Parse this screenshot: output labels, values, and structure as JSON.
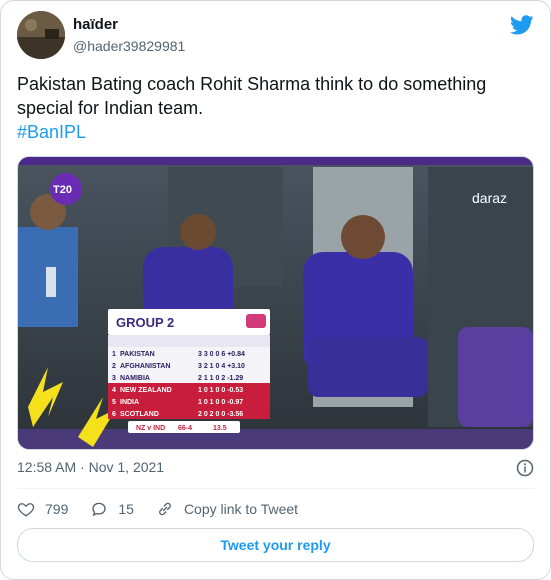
{
  "author": {
    "display_name": "haïder",
    "handle": "@hader39829981"
  },
  "tweet": {
    "text": "Pakistan Bating coach Rohit Sharma think to do something special for Indian team.",
    "hashtag": "#BanIPL",
    "timestamp": "12:58 AM · Nov 1, 2021"
  },
  "media": {
    "watermark": "daraz",
    "t20_logo": "T20",
    "group_table": {
      "title": "GROUP 2",
      "rows": [
        {
          "pos": "1",
          "team": "PAKISTAN",
          "vals": "3 3 0 0 6 +0.84"
        },
        {
          "pos": "2",
          "team": "AFGHANISTAN",
          "vals": "3 2 1 0 4 +3.10"
        },
        {
          "pos": "3",
          "team": "NAMIBIA",
          "vals": "2 1 1 0 2 -1.29"
        },
        {
          "pos": "4",
          "team": "NEW ZEALAND",
          "vals": "1 0 1 0 0 -0.53"
        },
        {
          "pos": "5",
          "team": "INDIA",
          "vals": "1 0 1 0 0 -0.97"
        },
        {
          "pos": "6",
          "team": "SCOTLAND",
          "vals": "2 0 2 0 0 -3.56"
        }
      ],
      "score_bar": {
        "teams": "NZ v IND",
        "score": "66-4",
        "overs": "13.5"
      }
    }
  },
  "actions": {
    "likes": "799",
    "replies": "15",
    "copy_link": "Copy link to Tweet",
    "reply_button": "Tweet your reply"
  },
  "colors": {
    "accent": "#1d9bf0",
    "muted": "#536471",
    "text": "#0f1419",
    "border": "#cfd9de"
  },
  "icons": [
    "twitter-bird-icon",
    "info-icon",
    "heart-icon",
    "reply-icon",
    "link-icon"
  ]
}
